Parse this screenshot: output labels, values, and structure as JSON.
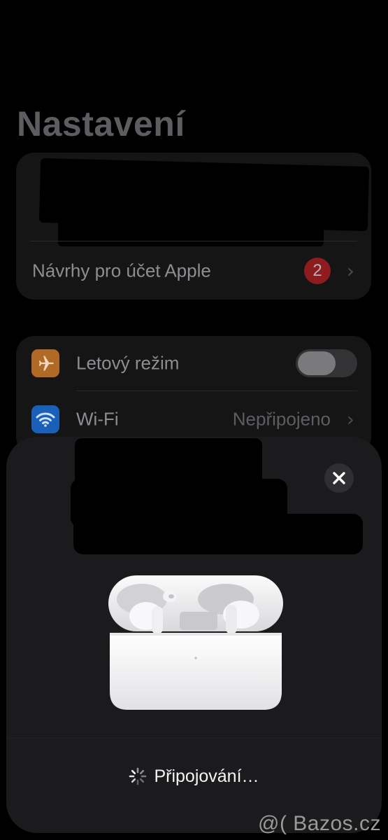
{
  "page_title": "Nastavení",
  "account_group": {
    "suggestions_label": "Návrhy pro účet Apple",
    "suggestions_badge": "2"
  },
  "network_group": {
    "airplane_label": "Letový režim",
    "airplane_enabled": false,
    "wifi_label": "Wi-Fi",
    "wifi_value": "Nepřipojeno"
  },
  "colors": {
    "airplane_tile": "#b06a26",
    "wifi_tile": "#1a60b8",
    "badge": "#8e1c1e"
  },
  "airpods_sheet": {
    "status": "Připojování…",
    "close_icon": "close-icon",
    "spinner_icon": "spinner-icon"
  },
  "watermark": "@( Bazos.cz"
}
